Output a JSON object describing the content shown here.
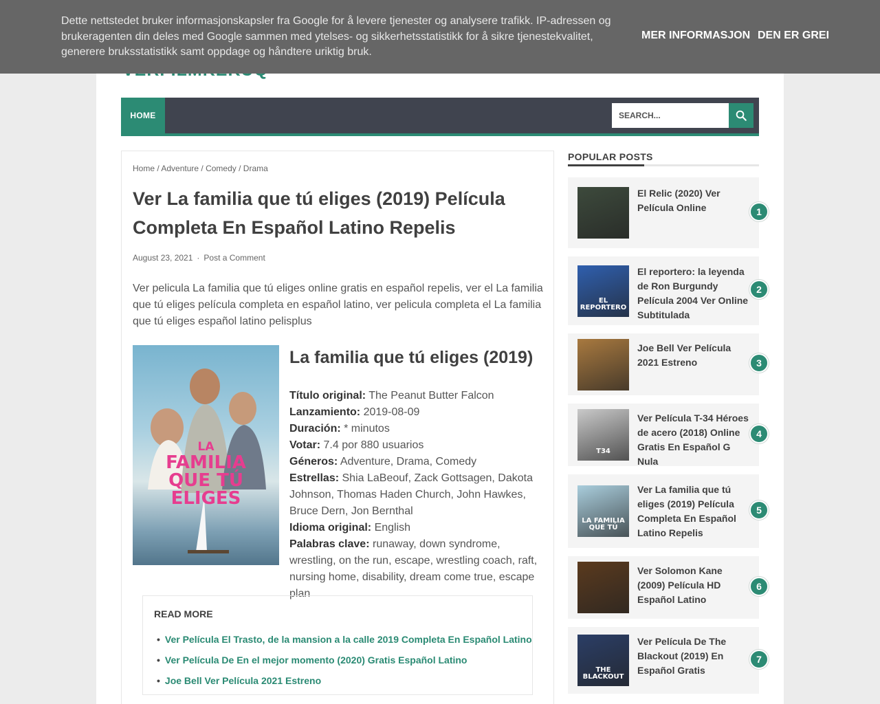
{
  "cookie": {
    "text": "Dette nettstedet bruker informasjonskapsler fra Google for å levere tjenester og analysere trafikk. IP-adressen og brukeragenten din deles med Google sammen med ytelses- og sikkerhetsstatistikk for å sikre tjenestekvalitet, generere bruksstatistikk samt oppdage og håndtere uriktig bruk.",
    "more_label": "Mer informasjon",
    "ok_label": "Den er grei"
  },
  "site": {
    "title": "VERFILMKEKUQ"
  },
  "nav": {
    "home_label": "HOME",
    "search_placeholder": "SEARCH..."
  },
  "breadcrumb": [
    "Home",
    "Adventure",
    "Comedy",
    "Drama"
  ],
  "post": {
    "title": "Ver La familia que tú eliges (2019) Película Completa En Español Latino Repelis",
    "date": "August 23, 2021",
    "comment_label": "Post a Comment",
    "intro": "Ver pelicula La familia que tú eliges online gratis en español repelis, ver el La familia que tú eliges película completa en español latino, ver pelicula completa el La familia que tú eliges español latino pelisplus",
    "poster_text": [
      "LA",
      "FAMILIA",
      "QUE TÚ",
      "ELIGES"
    ],
    "movie_title": "La familia que tú eliges (2019)",
    "details": [
      {
        "label": "Título original:",
        "value": "The Peanut Butter Falcon"
      },
      {
        "label": "Lanzamiento:",
        "value": "2019-08-09"
      },
      {
        "label": "Duración:",
        "value": "* minutos"
      },
      {
        "label": "Votar:",
        "value": "7.4 por 880 usuarios"
      },
      {
        "label": "Géneros:",
        "value": "Adventure, Drama, Comedy"
      },
      {
        "label": "Estrellas:",
        "value": "Shia LaBeouf, Zack Gottsagen, Dakota Johnson, Thomas Haden Church, John Hawkes, Bruce Dern, Jon Bernthal"
      },
      {
        "label": "Idioma original:",
        "value": "English"
      },
      {
        "label": "Palabras clave:",
        "value": "runaway, down syndrome, wrestling, on the run, escape, wrestling coach, raft, nursing home, disability, dream come true, escape plan"
      }
    ]
  },
  "readmore": {
    "title": "READ MORE",
    "items": [
      "Ver Película El Trasto, de la mansion a la calle 2019 Completa En Español Latino",
      "Ver Película De En el mejor momento (2020) Gratis Español Latino",
      "Joe Bell Ver Película 2021 Estreno"
    ]
  },
  "sidebar": {
    "title": "POPULAR POSTS",
    "posts": [
      {
        "num": "1",
        "title": "El Relic (2020) Ver Película Online",
        "thumb_color": "#3d4a3c"
      },
      {
        "num": "2",
        "title": "El reportero: la leyenda de Ron Burgundy Película 2004 Ver Online Subtitulada",
        "thumb_color": "#2f5fae",
        "thumb_text": "EL REPORTERO"
      },
      {
        "num": "3",
        "title": "Joe Bell Ver Película 2021 Estreno",
        "thumb_color": "#a8793f"
      },
      {
        "num": "4",
        "title": "Ver Película T-34 Héroes de acero (2018) Online Gratis En Español G Nula",
        "thumb_color": "#c9c9c9",
        "thumb_text": "T34"
      },
      {
        "num": "5",
        "title": "Ver La familia que tú eliges (2019) Película Completa En Español Latino Repelis",
        "thumb_color": "#a9cddc",
        "thumb_text": "LA FAMILIA QUE TÚ"
      },
      {
        "num": "6",
        "title": "Ver Solomon Kane (2009) Película HD Español Latino",
        "thumb_color": "#5a3a1e"
      },
      {
        "num": "7",
        "title": "Ver Película De The Blackout (2019) En Español Gratis",
        "thumb_color": "#2b3e66",
        "thumb_text": "THE BLACKOUT"
      }
    ]
  }
}
